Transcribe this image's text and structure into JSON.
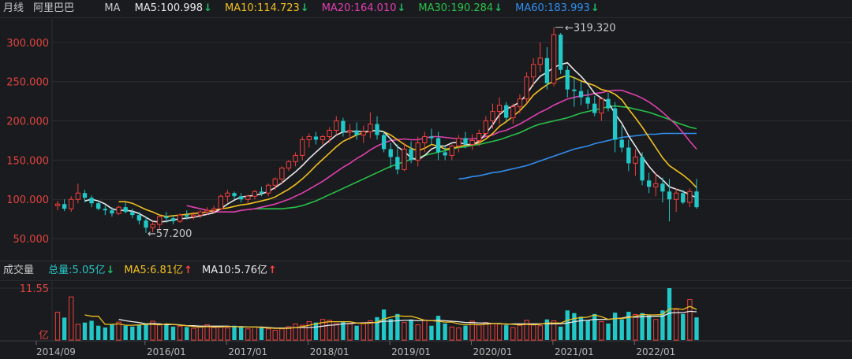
{
  "header": {
    "period_label": "月线",
    "stock_name": "阿里巴巴",
    "indicator": "MA",
    "ma_items": [
      {
        "text": "MA5:100.998",
        "color": "#e8e8e8",
        "arrow": "↓"
      },
      {
        "text": "MA10:114.723",
        "color": "#f0c020",
        "arrow": "↓"
      },
      {
        "text": "MA20:164.010",
        "color": "#e040b0",
        "arrow": "↓"
      },
      {
        "text": "MA30:190.284",
        "color": "#29c24a",
        "arrow": "↓"
      },
      {
        "text": "MA60:183.993",
        "color": "#2f8ef0",
        "arrow": "↓"
      }
    ]
  },
  "volume_header": {
    "title": "成交量",
    "items": [
      {
        "text": "总量:5.05亿",
        "color": "#26c6c6",
        "arrow": "↓"
      },
      {
        "text": "MA5:6.81亿",
        "color": "#f0c020",
        "arrow": "↑"
      },
      {
        "text": "MA10:5.76亿",
        "color": "#e8e8e8",
        "arrow": "↑"
      }
    ]
  },
  "chart_data": {
    "type": "candlestick",
    "y_ticks": [
      "300.000",
      "250.000",
      "200.000",
      "150.000",
      "100.000",
      "50.000"
    ],
    "ylim": [
      35,
      330
    ],
    "x_ticks": [
      "2014/09",
      "2016/01",
      "2017/01",
      "2018/01",
      "2019/01",
      "2020/01",
      "2021/01",
      "2022/01"
    ],
    "annotations": {
      "high_label": "319.320",
      "low_label": "57.200"
    },
    "volume": {
      "max_label": "11.55",
      "unit_label": "亿"
    },
    "ohlc": [
      [
        92,
        98,
        86,
        94
      ],
      [
        94,
        100,
        85,
        88
      ],
      [
        88,
        104,
        84,
        100
      ],
      [
        100,
        120,
        95,
        108
      ],
      [
        108,
        112,
        96,
        102
      ],
      [
        102,
        105,
        90,
        95
      ],
      [
        95,
        98,
        86,
        88
      ],
      [
        88,
        92,
        80,
        86
      ],
      [
        86,
        90,
        78,
        82
      ],
      [
        82,
        92,
        80,
        90
      ],
      [
        90,
        96,
        82,
        84
      ],
      [
        84,
        88,
        76,
        80
      ],
      [
        80,
        84,
        68,
        73
      ],
      [
        73,
        78,
        57.2,
        64
      ],
      [
        64,
        72,
        58,
        68
      ],
      [
        68,
        80,
        62,
        78
      ],
      [
        78,
        84,
        70,
        76
      ],
      [
        76,
        80,
        68,
        72
      ],
      [
        72,
        82,
        70,
        80
      ],
      [
        80,
        86,
        74,
        78
      ],
      [
        78,
        84,
        74,
        80
      ],
      [
        80,
        86,
        76,
        84
      ],
      [
        84,
        90,
        80,
        86
      ],
      [
        86,
        92,
        82,
        88
      ],
      [
        88,
        106,
        86,
        104
      ],
      [
        104,
        112,
        96,
        108
      ],
      [
        108,
        110,
        100,
        104
      ],
      [
        104,
        108,
        96,
        100
      ],
      [
        100,
        106,
        94,
        104
      ],
      [
        104,
        112,
        100,
        110
      ],
      [
        110,
        116,
        104,
        108
      ],
      [
        108,
        120,
        104,
        118
      ],
      [
        118,
        128,
        112,
        126
      ],
      [
        126,
        142,
        120,
        140
      ],
      [
        140,
        150,
        136,
        148
      ],
      [
        148,
        160,
        142,
        156
      ],
      [
        156,
        180,
        150,
        176
      ],
      [
        176,
        184,
        166,
        180
      ],
      [
        180,
        186,
        170,
        176
      ],
      [
        176,
        182,
        170,
        180
      ],
      [
        180,
        192,
        172,
        188
      ],
      [
        188,
        206,
        182,
        200
      ],
      [
        200,
        204,
        180,
        186
      ],
      [
        186,
        196,
        176,
        188
      ],
      [
        188,
        198,
        176,
        182
      ],
      [
        182,
        194,
        172,
        186
      ],
      [
        186,
        211,
        178,
        196
      ],
      [
        196,
        206,
        176,
        182
      ],
      [
        182,
        186,
        160,
        164
      ],
      [
        164,
        172,
        140,
        154
      ],
      [
        154,
        170,
        132,
        138
      ],
      [
        138,
        172,
        136,
        164
      ],
      [
        164,
        174,
        146,
        150
      ],
      [
        150,
        180,
        142,
        172
      ],
      [
        172,
        186,
        160,
        180
      ],
      [
        180,
        190,
        170,
        178
      ],
      [
        178,
        186,
        150,
        160
      ],
      [
        160,
        168,
        150,
        156
      ],
      [
        156,
        170,
        150,
        168
      ],
      [
        168,
        182,
        160,
        178
      ],
      [
        178,
        186,
        165,
        170
      ],
      [
        170,
        183,
        163,
        175
      ],
      [
        175,
        189,
        168,
        184
      ],
      [
        184,
        206,
        180,
        200
      ],
      [
        200,
        222,
        190,
        212
      ],
      [
        212,
        230,
        196,
        220
      ],
      [
        220,
        224,
        200,
        204
      ],
      [
        204,
        222,
        196,
        218
      ],
      [
        218,
        234,
        210,
        228
      ],
      [
        228,
        262,
        222,
        256
      ],
      [
        256,
        280,
        244,
        272
      ],
      [
        272,
        300,
        262,
        280
      ],
      [
        280,
        294,
        240,
        248
      ],
      [
        248,
        319.32,
        244,
        310
      ],
      [
        310,
        312,
        260,
        265
      ],
      [
        265,
        270,
        230,
        240
      ],
      [
        240,
        256,
        218,
        238
      ],
      [
        238,
        250,
        220,
        230
      ],
      [
        230,
        240,
        215,
        222
      ],
      [
        222,
        232,
        206,
        210
      ],
      [
        210,
        228,
        200,
        228
      ],
      [
        228,
        236,
        212,
        216
      ],
      [
        216,
        224,
        160,
        176
      ],
      [
        176,
        194,
        160,
        166
      ],
      [
        166,
        176,
        136,
        146
      ],
      [
        146,
        164,
        130,
        154
      ],
      [
        154,
        160,
        118,
        124
      ],
      [
        124,
        134,
        108,
        116
      ],
      [
        116,
        134,
        104,
        120
      ],
      [
        120,
        128,
        96,
        110
      ],
      [
        110,
        126,
        72,
        100
      ],
      [
        100,
        114,
        84,
        108
      ],
      [
        108,
        112,
        94,
        96
      ],
      [
        96,
        114,
        90,
        110
      ],
      [
        110,
        126,
        88,
        90
      ]
    ],
    "ma": {
      "MA5": [
        null,
        null,
        null,
        null,
        98,
        100,
        98,
        94,
        88,
        86,
        86,
        85,
        82,
        77,
        72,
        71,
        72,
        74,
        75,
        76,
        77,
        79,
        81,
        83,
        88,
        94,
        99,
        103,
        104,
        105,
        107,
        110,
        115,
        121,
        128,
        135,
        143,
        152,
        160,
        168,
        175,
        182,
        186,
        186,
        187,
        186,
        187,
        188,
        186,
        177,
        167,
        161,
        153,
        150,
        156,
        164,
        168,
        168,
        172,
        173,
        170,
        170,
        174,
        184,
        195,
        208,
        215,
        219,
        224,
        234,
        247,
        257,
        262,
        268,
        272,
        274,
        265,
        257,
        247,
        235,
        229,
        224,
        209,
        197,
        181,
        168,
        154,
        142,
        132,
        125,
        116,
        113,
        110,
        106,
        102
      ],
      "MA10": [
        null,
        null,
        null,
        null,
        null,
        null,
        null,
        null,
        null,
        97,
        97,
        95,
        91,
        87,
        84,
        80,
        78,
        79,
        80,
        81,
        82,
        83,
        84,
        86,
        88,
        89,
        91,
        93,
        94,
        96,
        98,
        100,
        103,
        108,
        113,
        119,
        126,
        134,
        143,
        151,
        159,
        167,
        174,
        178,
        182,
        185,
        187,
        188,
        186,
        182,
        176,
        170,
        165,
        162,
        165,
        170,
        168,
        164,
        165,
        167,
        169,
        170,
        172,
        177,
        184,
        193,
        199,
        206,
        213,
        222,
        233,
        240,
        246,
        251,
        255,
        258,
        255,
        251,
        248,
        245,
        240,
        238,
        234,
        227,
        215,
        204,
        192,
        179,
        166,
        153,
        143,
        137,
        131,
        124,
        115
      ],
      "MA20": [
        null,
        null,
        null,
        null,
        null,
        null,
        null,
        null,
        null,
        null,
        null,
        null,
        null,
        null,
        null,
        null,
        null,
        null,
        null,
        92,
        90,
        88,
        86,
        84,
        84,
        84,
        84,
        86,
        87,
        88,
        90,
        92,
        94,
        97,
        100,
        104,
        108,
        113,
        118,
        123,
        129,
        135,
        141,
        146,
        152,
        157,
        163,
        168,
        172,
        175,
        176,
        177,
        176,
        176,
        178,
        180,
        180,
        179,
        178,
        177,
        177,
        177,
        178,
        180,
        182,
        186,
        188,
        192,
        196,
        201,
        206,
        211,
        215,
        220,
        224,
        228,
        230,
        232,
        233,
        235,
        236,
        238,
        239,
        239,
        236,
        233,
        229,
        224,
        218,
        211,
        203,
        195,
        185,
        174,
        164
      ],
      "MA30": [
        null,
        null,
        null,
        null,
        null,
        null,
        null,
        null,
        null,
        null,
        null,
        null,
        null,
        null,
        null,
        null,
        null,
        null,
        null,
        null,
        null,
        null,
        null,
        null,
        null,
        null,
        null,
        null,
        null,
        88,
        88,
        88,
        88,
        88,
        89,
        90,
        92,
        95,
        98,
        102,
        106,
        110,
        114,
        118,
        122,
        126,
        130,
        134,
        138,
        142,
        145,
        148,
        151,
        153,
        156,
        158,
        160,
        162,
        164,
        166,
        167,
        169,
        170,
        172,
        174,
        176,
        179,
        182,
        185,
        189,
        193,
        196,
        198,
        200,
        202,
        204,
        207,
        210,
        212,
        214,
        216,
        218,
        219,
        218,
        217,
        215,
        213,
        211,
        208,
        205,
        202,
        198,
        195,
        192,
        190
      ],
      "MA60": [
        null,
        null,
        null,
        null,
        null,
        null,
        null,
        null,
        null,
        null,
        null,
        null,
        null,
        null,
        null,
        null,
        null,
        null,
        null,
        null,
        null,
        null,
        null,
        null,
        null,
        null,
        null,
        null,
        null,
        null,
        null,
        null,
        null,
        null,
        null,
        null,
        null,
        null,
        null,
        null,
        null,
        null,
        null,
        null,
        null,
        null,
        null,
        null,
        null,
        null,
        null,
        null,
        null,
        null,
        null,
        null,
        null,
        null,
        null,
        126,
        127,
        129,
        130,
        132,
        134,
        135,
        137,
        139,
        141,
        143,
        146,
        149,
        152,
        155,
        158,
        161,
        164,
        166,
        168,
        171,
        173,
        175,
        177,
        179,
        180,
        181,
        182,
        183,
        183,
        184,
        184,
        184,
        184,
        184,
        184
      ]
    },
    "volumes": [
      6.2,
      5.0,
      9.6,
      3.5,
      3.9,
      4.3,
      3.2,
      2.8,
      3.5,
      4.0,
      3.2,
      3.0,
      3.4,
      3.7,
      4.2,
      3.6,
      3.3,
      3.0,
      3.1,
      2.9,
      2.6,
      3.0,
      3.4,
      2.8,
      3.0,
      2.7,
      3.2,
      3.0,
      2.5,
      2.9,
      2.7,
      2.5,
      2.2,
      2.5,
      3.0,
      3.6,
      3.3,
      4.1,
      3.9,
      4.6,
      4.4,
      3.7,
      4.0,
      3.6,
      3.2,
      3.9,
      4.3,
      5.1,
      6.8,
      4.7,
      5.8,
      3.9,
      4.6,
      3.4,
      4.4,
      3.2,
      5.4,
      3.7,
      2.9,
      2.7,
      3.2,
      4.2,
      3.4,
      3.9,
      3.7,
      3.6,
      3.3,
      2.8,
      3.3,
      4.4,
      3.6,
      3.2,
      4.6,
      4.3,
      3.0,
      6.6,
      6.0,
      5.2,
      4.4,
      5.8,
      4.1,
      3.7,
      6.1,
      4.6,
      6.3,
      5.7,
      6.0,
      5.6,
      4.6,
      6.6,
      11.55,
      6.8,
      5.8,
      9.0,
      5.05
    ],
    "vol_ma5": [
      null,
      null,
      null,
      null,
      5.6,
      5.3,
      5.3,
      3.5,
      3.5,
      3.6,
      3.3,
      3.3,
      3.4,
      3.5,
      3.5,
      3.4,
      3.6,
      3.5,
      3.3,
      3.2,
      3.0,
      2.9,
      3.0,
      2.9,
      2.9,
      3.0,
      3.0,
      2.9,
      2.9,
      2.9,
      2.8,
      2.7,
      2.6,
      2.6,
      2.6,
      2.8,
      3.0,
      3.3,
      3.6,
      3.9,
      4.1,
      4.1,
      4.1,
      4.1,
      3.8,
      3.7,
      3.8,
      4.0,
      4.7,
      5.1,
      5.4,
      5.3,
      5.3,
      4.9,
      4.4,
      4.3,
      4.2,
      4.0,
      4.0,
      3.6,
      3.4,
      3.5,
      3.4,
      3.5,
      3.7,
      3.6,
      3.6,
      3.5,
      3.4,
      3.5,
      3.4,
      3.5,
      3.8,
      3.8,
      3.8,
      4.4,
      4.8,
      5.0,
      5.1,
      5.6,
      5.2,
      4.6,
      4.8,
      4.8,
      5.0,
      5.3,
      5.7,
      5.6,
      5.6,
      5.7,
      6.9,
      7.0,
      6.8,
      7.5,
      6.81
    ],
    "vol_ma10": [
      null,
      null,
      null,
      null,
      null,
      null,
      null,
      null,
      null,
      4.6,
      4.3,
      4.1,
      3.9,
      3.6,
      3.7,
      3.6,
      3.4,
      3.5,
      3.4,
      3.2,
      3.2,
      3.1,
      3.1,
      3.1,
      3.1,
      3.1,
      3.0,
      3.0,
      2.9,
      2.9,
      2.9,
      2.8,
      2.7,
      2.7,
      2.7,
      2.8,
      2.8,
      2.8,
      2.9,
      3.1,
      3.3,
      3.4,
      3.6,
      3.7,
      3.8,
      3.8,
      3.9,
      3.9,
      4.2,
      4.2,
      4.3,
      4.4,
      4.4,
      4.3,
      4.4,
      4.3,
      4.4,
      4.3,
      4.2,
      4.1,
      3.9,
      3.9,
      3.8,
      3.8,
      3.7,
      3.7,
      3.5,
      3.6,
      3.6,
      3.6,
      3.6,
      3.6,
      3.6,
      3.6,
      3.6,
      3.8,
      4.1,
      4.3,
      4.4,
      4.6,
      4.6,
      4.6,
      4.8,
      4.9,
      5.2,
      5.1,
      5.2,
      5.2,
      5.3,
      5.3,
      6.0,
      6.1,
      6.1,
      6.4,
      6.3
    ]
  }
}
